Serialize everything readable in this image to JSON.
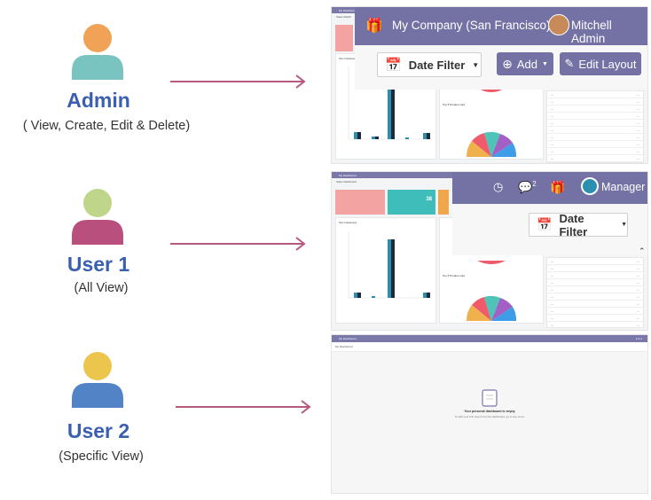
{
  "roles": [
    {
      "name": "Admin",
      "desc": "( View, Create, Edit & Delete)",
      "head_color": "#f0a257",
      "body_color": "#79c3c0"
    },
    {
      "name": "User 1",
      "desc": "(All View)",
      "head_color": "#bfd68a",
      "body_color": "#b84f7c"
    },
    {
      "name": "User 2",
      "desc": "(Specific View)",
      "head_color": "#ecc54d",
      "body_color": "#5283c6"
    }
  ],
  "arrow_color": "#b55a7e",
  "admin_shot": {
    "company": "My Company (San Francisco)",
    "user": "Mitchell Admin",
    "date_filter": "Date Filter",
    "add": "Add",
    "edit_layout": "Edit Layout",
    "bg_title": "My Dashboard",
    "bg_subtitle": "Sales Dashb",
    "customers_title": "Top Customers",
    "products_title": "Top 5 Product sold"
  },
  "user1_shot": {
    "bg_title": "My Dashboard",
    "bg_subtitle": "Sales Dashboard",
    "user": "Manager",
    "date_filter": "Date Filter",
    "chat_count": "2",
    "tile_value": "38",
    "customers_title": "Top Customers",
    "products_title": "Top 5 Product sold"
  },
  "user2_shot": {
    "title": "My Dashboard",
    "breadcrumb": "My Dashboard",
    "empty_title": "Your personal dashboard is empty",
    "empty_hint": "To add your first report into this dashboard, go to any menu"
  },
  "colors": {
    "accent": "#7471a5",
    "bar_blue": "#2b8fb0",
    "bar_dark": "#1d2a3a",
    "tile_pink": "#f4a3a3",
    "tile_teal": "#3ebdbb",
    "tile_orange": "#f0a64b"
  }
}
